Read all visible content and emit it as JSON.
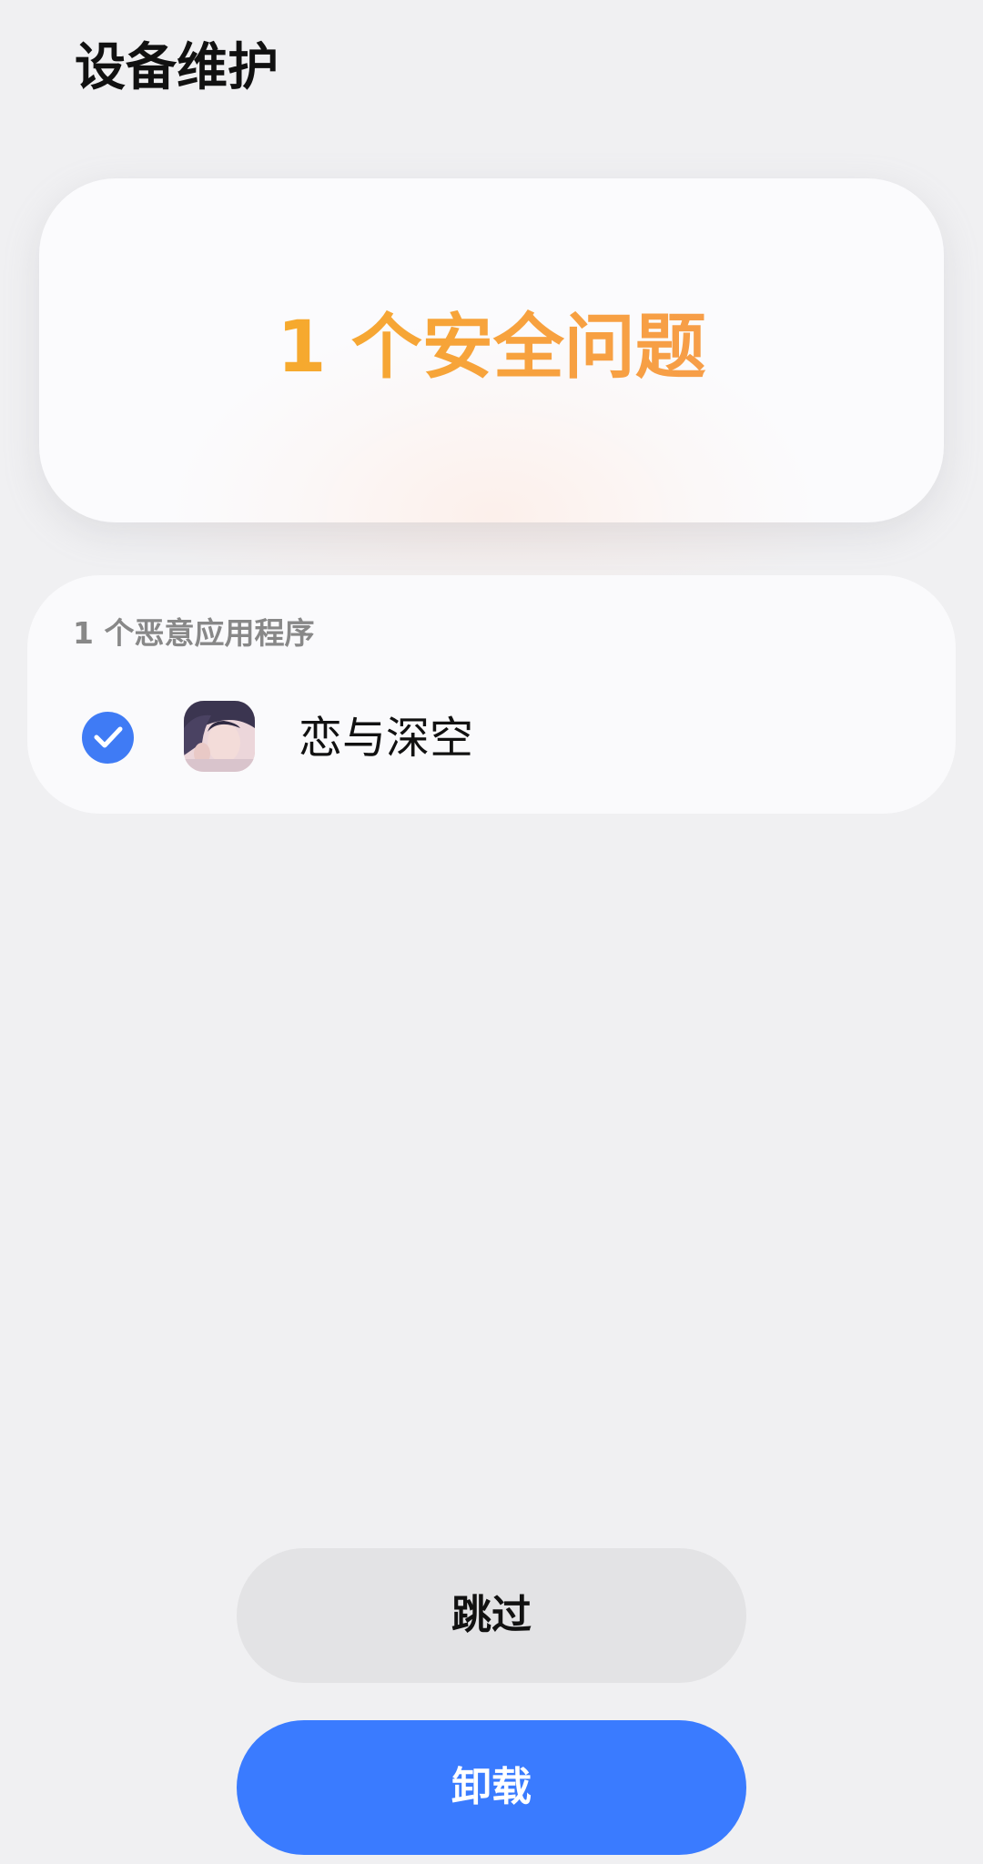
{
  "header": {
    "title": "设备维护"
  },
  "summary": {
    "text": "1 个安全问题",
    "accent_color": "#F6A53A"
  },
  "malicious_apps": {
    "section_title": "1 个恶意应用程序",
    "items": [
      {
        "name": "恋与深空",
        "checked": true,
        "icon": "app-icon-portrait"
      }
    ]
  },
  "actions": {
    "skip_label": "跳过",
    "uninstall_label": "卸载",
    "primary_color": "#3A7BFF"
  }
}
